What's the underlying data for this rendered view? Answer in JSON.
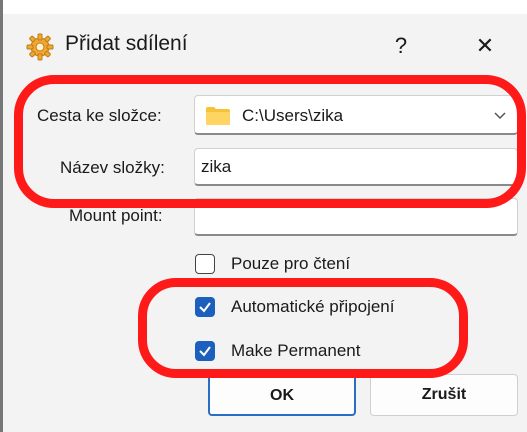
{
  "dialog": {
    "title": "Přidat sdílení",
    "help_glyph": "?",
    "close_glyph": "✕"
  },
  "form": {
    "path_label": "Cesta ke složce:",
    "path_value": "C:\\Users\\zika",
    "name_label": "Název složky:",
    "name_value": "zika",
    "mount_label": "Mount point:",
    "mount_value": ""
  },
  "options": {
    "readonly_label": "Pouze pro čtení",
    "readonly_checked": false,
    "automount_label": "Automatické připojení",
    "automount_checked": true,
    "permanent_label": "Make Permanent",
    "permanent_checked": true
  },
  "buttons": {
    "ok_label": "OK",
    "cancel_label": "Zrušit"
  },
  "colors": {
    "accent": "#1d5fbd",
    "highlight": "#ff1a1a"
  }
}
